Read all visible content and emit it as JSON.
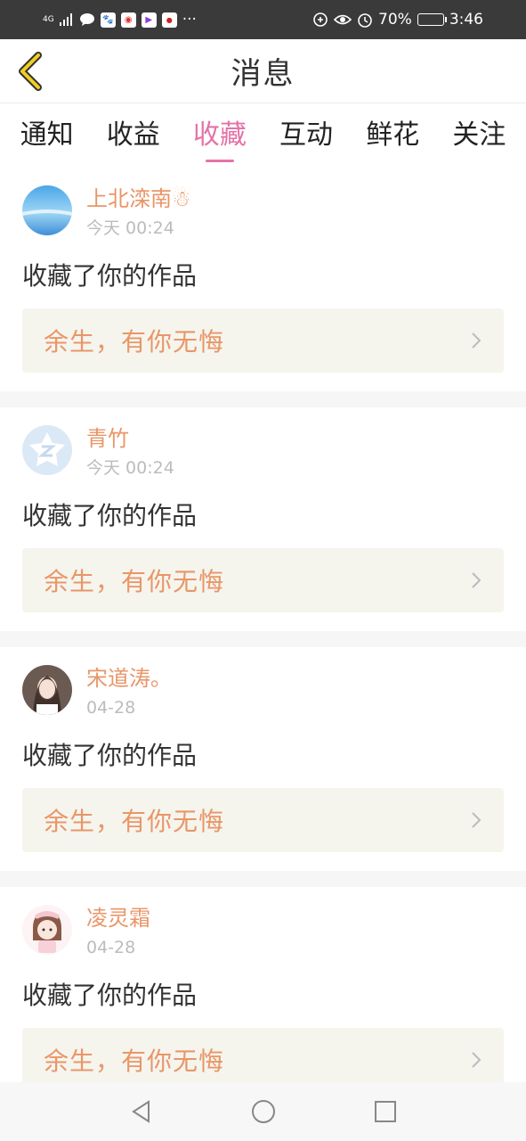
{
  "status_bar": {
    "network": "4G",
    "battery_text": "70%",
    "time": "3:46",
    "more": "···",
    "notification_icons": [
      "message-icon",
      "baidu-icon",
      "weibo-icon",
      "video-icon",
      "app-icon"
    ]
  },
  "header": {
    "title": "消息"
  },
  "tabs": [
    {
      "label": "通知"
    },
    {
      "label": "收益"
    },
    {
      "label": "收藏"
    },
    {
      "label": "互动"
    },
    {
      "label": "鲜花"
    },
    {
      "label": "关注"
    }
  ],
  "active_tab": "收藏",
  "messages": [
    {
      "name": "上北滦南☃",
      "time": "今天 00:24",
      "action": "收藏了你的作品",
      "work": "余生，有你无悔"
    },
    {
      "name": "青竹",
      "time": "今天 00:24",
      "action": "收藏了你的作品",
      "work": "余生，有你无悔"
    },
    {
      "name": "宋道涛。",
      "time": "04-28",
      "action": "收藏了你的作品",
      "work": "余生，有你无悔"
    },
    {
      "name": "凌灵霜",
      "time": "04-28",
      "action": "收藏了你的作品",
      "work": "余生，有你无悔"
    }
  ],
  "colors": {
    "accent": "#e573a8",
    "name": "#e99668",
    "back_arrow": "#e8c21a"
  }
}
